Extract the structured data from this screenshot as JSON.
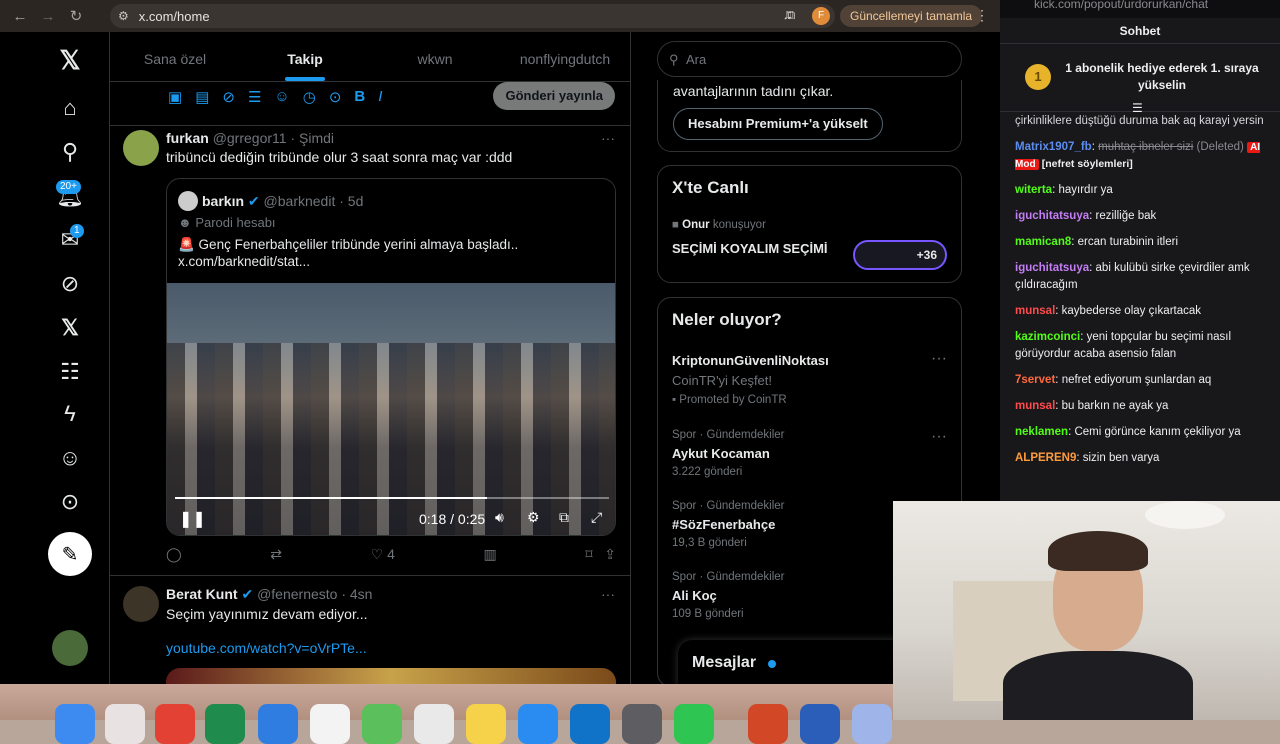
{
  "browser": {
    "url": "x.com/home",
    "update_label": "Güncellemeyi tamamla",
    "profile_initial": "F"
  },
  "nav": {
    "notif_badge": "20+",
    "mail_badge": "1"
  },
  "tabs": [
    "Sana özel",
    "Takip",
    "wkwn",
    "nonflyingdutch"
  ],
  "compose": {
    "post_label": "Gönderi yayınla"
  },
  "tweet1": {
    "name": "furkan",
    "handle": "@grregor11",
    "time": "· Şimdi",
    "text": "tribüncü dediğin tribünde olur 3 saat sonra maç var :ddd",
    "quote": {
      "name": "barkın",
      "handle": "@barknedit",
      "time": "· 5d",
      "parody": "Parodi hesabı",
      "text": "🚨 Genç Fenerbahçeliler tribünde yerini almaya başladı..",
      "link": "x.com/barknedit/stat..."
    },
    "video": {
      "time": "0:18 / 0:25",
      "progress": 0.72
    },
    "likes": "4"
  },
  "tweet2": {
    "name": "Berat Kunt",
    "handle": "@fenernesto",
    "time": "· 4sn",
    "text": "Seçim yayınımız devam ediyor...",
    "link": "youtube.com/watch?v=oVrPTe..."
  },
  "right": {
    "search_placeholder": "Ara",
    "premium_text": "avantajlarının tadını çıkar.",
    "premium_button": "Hesabını Premium+'a yükselt",
    "live": {
      "title": "X'te Canlı",
      "host": "Onur",
      "speaking": "konuşuyor",
      "space": "SEÇİMİ KOYALIM SEÇİMİ",
      "count": "+36"
    },
    "trends_title": "Neler oluyor?",
    "trends": [
      {
        "meta": "",
        "name": "KriptonunGüvenliNoktası",
        "sub": "CoinTR'yi Keşfet!",
        "promo": "Promoted by CoinTR"
      },
      {
        "meta": "Spor · Gündemdekiler",
        "name": "Aykut Kocaman",
        "sub": "3.222 gönderi"
      },
      {
        "meta": "Spor · Gündemdekiler",
        "name": "#SözFenerbahçe",
        "sub": "19,3 B gönderi"
      },
      {
        "meta": "Spor · Gündemdekiler",
        "name": "Ali Koç",
        "sub": "109 B gönderi"
      }
    ],
    "messages": "Mesajlar"
  },
  "chat": {
    "top_url": "kick.com/popout/urdorurkan/chat",
    "title": "Sohbet",
    "gift_rank": "1",
    "gift": "1 abonelik hediye ederek 1. sıraya yükselin",
    "partial": "çirkinliklere düştüğü duruma bak aq karayi yersin",
    "messages": [
      {
        "user": "Matrix1907_fb",
        "color": "#5b8def",
        "text": "muhtaç ibneler sizi",
        "deleted": true,
        "deleted_label": "(Deleted)",
        "mod": "AI Mod",
        "note": "[nefret söylemleri]"
      },
      {
        "user": "witerta",
        "color": "#53fc18",
        "text": "hayırdır ya"
      },
      {
        "user": "iguchitatsuya",
        "color": "#c37ef4",
        "text": "rezilliğe bak"
      },
      {
        "user": "mamican8",
        "color": "#53fc18",
        "text": "ercan turabinin itleri"
      },
      {
        "user": "iguchitatsuya",
        "color": "#c37ef4",
        "text": "abi kulübü sirke çevirdiler amk çıldıracağım"
      },
      {
        "user": "munsal",
        "color": "#ff4b4b",
        "text": "kaybederse olay çıkartacak"
      },
      {
        "user": "kazimcoinci",
        "color": "#53fc18",
        "text": "yeni topçular bu seçimi nasıl görüyordur acaba asensio falan"
      },
      {
        "user": "7servet",
        "color": "#ff6a3d",
        "text": "nefret ediyorum şunlardan aq"
      },
      {
        "user": "munsal",
        "color": "#ff4b4b",
        "text": "bu barkın ne ayak ya"
      },
      {
        "user": "neklamen",
        "color": "#53fc18",
        "text": "Cemi görünce kanım çekiliyor ya"
      },
      {
        "user": "ALPEREN9",
        "color": "#ff9b3d",
        "text": "sizin ben varya"
      }
    ]
  }
}
